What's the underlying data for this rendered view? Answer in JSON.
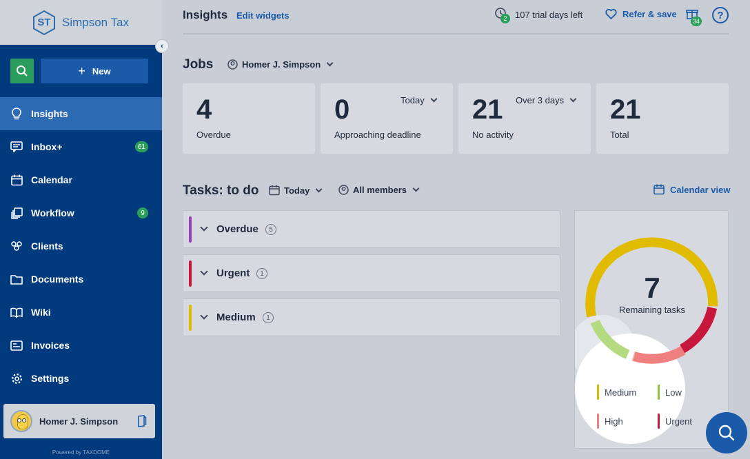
{
  "brand": {
    "initials": "ST",
    "name": "Simpson Tax"
  },
  "sidebar": {
    "new_label": "New",
    "items": [
      {
        "label": "Insights",
        "icon": "lightbulb-icon",
        "badge": ""
      },
      {
        "label": "Inbox+",
        "icon": "inbox-icon",
        "badge": "61"
      },
      {
        "label": "Calendar",
        "icon": "calendar-icon",
        "badge": ""
      },
      {
        "label": "Workflow",
        "icon": "workflow-icon",
        "badge": "9"
      },
      {
        "label": "Clients",
        "icon": "clients-icon",
        "badge": ""
      },
      {
        "label": "Documents",
        "icon": "folder-icon",
        "badge": ""
      },
      {
        "label": "Wiki",
        "icon": "book-icon",
        "badge": ""
      },
      {
        "label": "Invoices",
        "icon": "invoice-icon",
        "badge": ""
      },
      {
        "label": "Settings",
        "icon": "gear-icon",
        "badge": ""
      }
    ],
    "user_name": "Homer J. Simpson",
    "powered_by": "Powered by TAXDOME"
  },
  "header": {
    "title": "Insights",
    "edit_widgets": "Edit widgets",
    "clock_badge": "2",
    "trial_text": "107 trial days left",
    "refer_label": "Refer & save",
    "gift_badge": "34",
    "help_label": "?"
  },
  "jobs": {
    "title": "Jobs",
    "member": "Homer J. Simpson",
    "cards": [
      {
        "value": "4",
        "label": "Overdue",
        "filter": ""
      },
      {
        "value": "0",
        "label": "Approaching deadline",
        "filter": "Today"
      },
      {
        "value": "21",
        "label": "No activity",
        "filter": "Over 3 days"
      },
      {
        "value": "21",
        "label": "Total",
        "filter": ""
      }
    ]
  },
  "tasks": {
    "title": "Tasks: to do",
    "date_filter": "Today",
    "member_filter": "All members",
    "calendar_view": "Calendar view",
    "groups": [
      {
        "label": "Overdue",
        "count": "5",
        "color": "#9b3fb5"
      },
      {
        "label": "Urgent",
        "count": "1",
        "color": "#c8173c"
      },
      {
        "label": "Medium",
        "count": "1",
        "color": "#e0bb00"
      }
    ]
  },
  "donut": {
    "remaining": "7",
    "remaining_label": "Remaining tasks",
    "legend": [
      {
        "label": "Medium",
        "color": "#e0bb00"
      },
      {
        "label": "Low",
        "color": "#8cc63f"
      },
      {
        "label": "High",
        "color": "#f08080"
      },
      {
        "label": "Urgent",
        "color": "#c8173c"
      }
    ]
  }
}
